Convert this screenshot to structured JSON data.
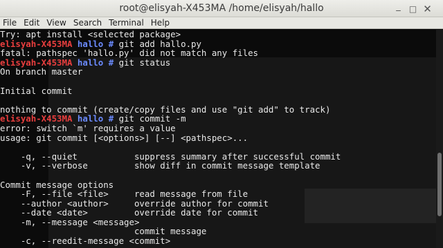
{
  "window": {
    "title": "root@elisyah-X453MA /home/elisyah/hallo",
    "buttons": {
      "minimize": "_",
      "maximize": "□",
      "close": "✕"
    }
  },
  "menu": [
    "File",
    "Edit",
    "View",
    "Search",
    "Terminal",
    "Help"
  ],
  "prompt": {
    "user": "elisyah-X453MA",
    "dir": "hallo",
    "symbol": "#"
  },
  "lines": [
    {
      "type": "out",
      "text": "Try: apt install <selected package>"
    },
    {
      "type": "cmd",
      "cmd": "git add hallo.py"
    },
    {
      "type": "out",
      "text": "fatal: pathspec 'hallo.py' did not match any files"
    },
    {
      "type": "cmd",
      "cmd": "git status"
    },
    {
      "type": "out",
      "text": "On branch master"
    },
    {
      "type": "out",
      "text": ""
    },
    {
      "type": "out",
      "text": "Initial commit"
    },
    {
      "type": "out",
      "text": ""
    },
    {
      "type": "out",
      "text": "nothing to commit (create/copy files and use \"git add\" to track)"
    },
    {
      "type": "cmd",
      "cmd": "git commit -m"
    },
    {
      "type": "out",
      "text": "error: switch `m' requires a value"
    },
    {
      "type": "out",
      "text": "usage: git commit [<options>] [--] <pathspec>..."
    },
    {
      "type": "out",
      "text": ""
    },
    {
      "type": "out",
      "text": "    -q, --quiet           suppress summary after successful commit"
    },
    {
      "type": "out",
      "text": "    -v, --verbose         show diff in commit message template"
    },
    {
      "type": "out",
      "text": ""
    },
    {
      "type": "out",
      "text": "Commit message options"
    },
    {
      "type": "out",
      "text": "    -F, --file <file>     read message from file"
    },
    {
      "type": "out",
      "text": "    --author <author>     override author for commit"
    },
    {
      "type": "out",
      "text": "    --date <date>         override date for commit"
    },
    {
      "type": "out",
      "text": "    -m, --message <message>"
    },
    {
      "type": "out",
      "text": "                          commit message"
    },
    {
      "type": "out",
      "text": "    -c, --reedit-message <commit>"
    }
  ],
  "colors": {
    "user": "#e93e3e",
    "dir": "#6b8bff",
    "text": "#e9e9e9",
    "bg": "#0b0b0b"
  }
}
